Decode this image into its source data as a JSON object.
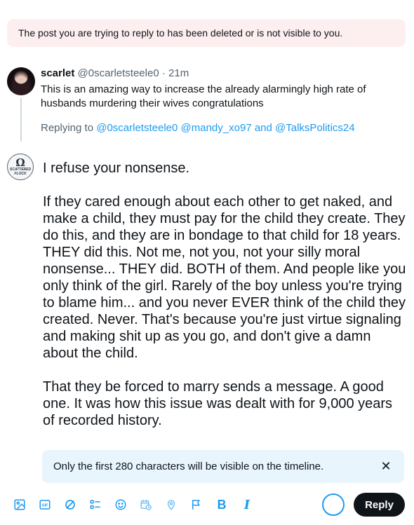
{
  "notice": {
    "text": "The post you are trying to reply to has been deleted or is not visible to you."
  },
  "original_post": {
    "display_name": "scarlet",
    "handle": "@0scarletsteele0",
    "separator": "·",
    "time": "21m",
    "text": "This is an amazing way to increase the already alarmingly high rate of husbands murdering their wives congratulations"
  },
  "replying_to": {
    "prefix": "Replying to",
    "mention1": "@0scarletsteele0",
    "mention2": "@mandy_xo97",
    "conjunction": "and",
    "mention3": "@TalksPolitics24"
  },
  "my_avatar": {
    "symbol": "Ω",
    "caption": "SCATTERED FLOCK"
  },
  "compose": {
    "paragraphs": [
      "I refuse your nonsense.",
      "If they cared enough about each other to get naked, and make a child, they must pay for the child they create.  They do this, and they are in bondage to that child for 18 years.  THEY did this.  Not me, not you, not your silly moral nonsense... THEY did.  BOTH of them.  And people like you only think of the girl.  Rarely of the boy unless you're trying to blame him... and you never EVER think of the child they created.  Never.  That's because you're just virtue signaling and making shit up as you go, and don't give a damn about the child.",
      "That they be forced to marry sends a message.  A good one.  It was how this issue was dealt with for 9,000 years of recorded history."
    ]
  },
  "warning": {
    "text": "Only the first 280 characters will be visible on the timeline.",
    "close": "✕"
  },
  "toolbar": {
    "icons": [
      "image-icon",
      "gif-icon",
      "grok-icon",
      "poll-icon",
      "emoji-icon",
      "schedule-icon",
      "location-icon",
      "flag-icon",
      "bold-icon",
      "italic-icon"
    ],
    "gif_label": "GIF",
    "bold_label": "B",
    "italic_label": "I",
    "reply_label": "Reply"
  },
  "colors": {
    "accent": "#1d9bf0",
    "reply_button": "#0f1419",
    "notice_bg": "#fdeff0",
    "warning_bg": "#e8f5fd"
  }
}
